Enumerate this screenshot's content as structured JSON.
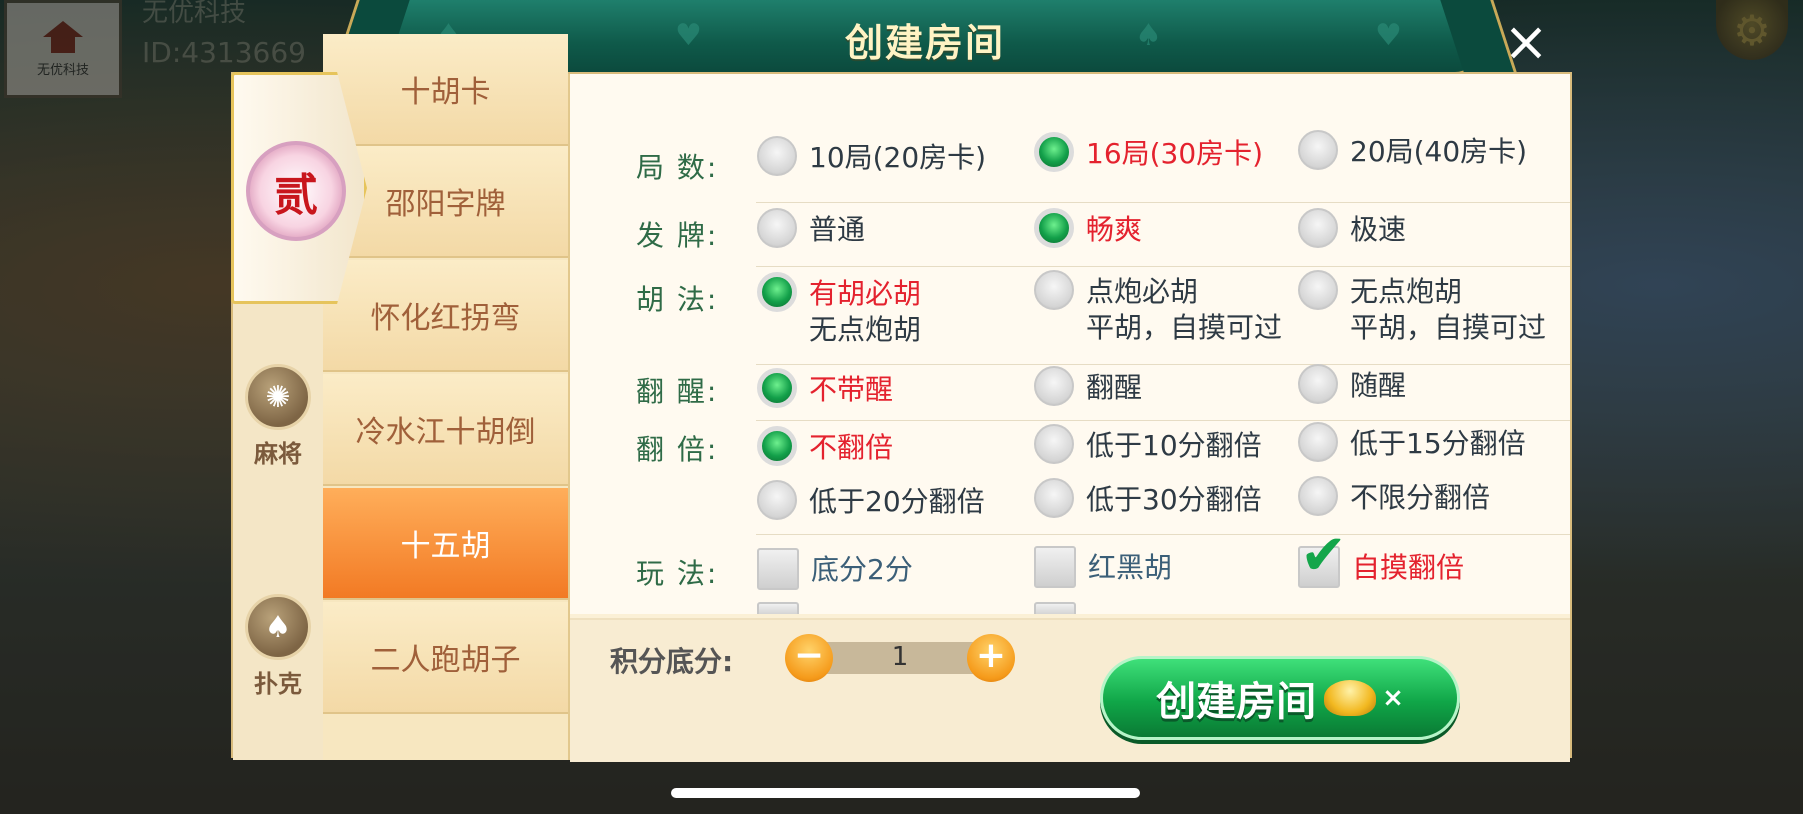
{
  "user": {
    "logo_text": "无优科技",
    "name": "无优科技",
    "id": "ID:4313669"
  },
  "dialog": {
    "title": "创建房间",
    "close_label": "×"
  },
  "categories": [
    {
      "label": "",
      "badge": "贰",
      "icon": "medal-icon"
    },
    {
      "label": "麻将",
      "icon": "mahjong-icon"
    },
    {
      "label": "扑克",
      "icon": "spade-icon"
    }
  ],
  "games": [
    "十胡卡",
    "邵阳字牌",
    "怀化红拐弯",
    "冷水江十胡倒",
    "十五胡",
    "二人跑胡子"
  ],
  "selected_game": "十五胡",
  "rows": {
    "rounds": {
      "label": "局  数:",
      "options": [
        "10局(20房卡)",
        "16局(30房卡)",
        "20局(40房卡)"
      ],
      "selected": "16局(30房卡)"
    },
    "deal": {
      "label": "发  牌:",
      "options": [
        "普通",
        "畅爽",
        "极速"
      ],
      "selected": "畅爽"
    },
    "hu": {
      "label": "胡  法:",
      "options": [
        {
          "line1": "有胡必胡",
          "line2": "无点炮胡"
        },
        {
          "line1": "点炮必胡",
          "line2": "平胡，自摸可过"
        },
        {
          "line1": "无点炮胡",
          "line2": "平胡，自摸可过"
        }
      ],
      "selected": "有胡必胡"
    },
    "xing": {
      "label": "翻  醒:",
      "options": [
        "不带醒",
        "翻醒",
        "随醒"
      ],
      "selected": "不带醒"
    },
    "multiplier": {
      "label": "翻  倍:",
      "options": [
        "不翻倍",
        "低于10分翻倍",
        "低于15分翻倍",
        "低于20分翻倍",
        "低于30分翻倍",
        "不限分翻倍"
      ],
      "selected": "不翻倍"
    },
    "play": {
      "label": "玩  法:",
      "options": [
        {
          "text": "底分2分",
          "checked": false
        },
        {
          "text": "红黑胡",
          "checked": false
        },
        {
          "text": "自摸翻倍",
          "checked": true
        }
      ]
    }
  },
  "score": {
    "label": "积分底分:",
    "value": "1",
    "minus": "−",
    "plus": "+"
  },
  "create_button": {
    "label": "创建房间",
    "cost_suffix": "×"
  },
  "colors": {
    "accent_green": "#10a648",
    "selected_red": "#e4222e",
    "active_tab": "#f27a24",
    "title_bar": "#0f5a4a"
  }
}
